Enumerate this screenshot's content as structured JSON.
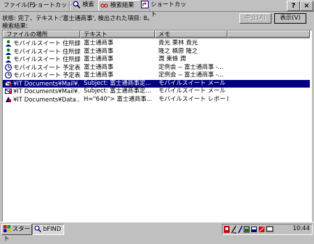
{
  "menubar": {
    "file": "ファイル(F)",
    "shortcut": "ショートカット(S)"
  },
  "tabs": [
    {
      "label": "検索",
      "icon": "magnifier-icon"
    },
    {
      "label": "検索結果",
      "icon": "glasses-icon"
    },
    {
      "label": "ショートカット",
      "icon": "shortcut-icon"
    }
  ],
  "window_buttons": {
    "help": "?",
    "close": "×"
  },
  "status": {
    "text": "状態:  完了、テキスト:'富士通商事',  検出された項目: 8。",
    "results_label": "検索結果:"
  },
  "buttons": {
    "stop": "中止(A)",
    "view": "表示(V)"
  },
  "list": {
    "columns": [
      "ファイルの場所",
      "テキスト",
      "メモ"
    ],
    "rows": [
      {
        "icon": "contact-icon",
        "location": "モバイルスイート 住所録",
        "text": "富士通商事",
        "memo": "貴光 栗林 貴光",
        "selected": false
      },
      {
        "icon": "contact-icon",
        "location": "モバイルスイート 住所録",
        "text": "富士通商事",
        "memo": "隆之 槙原 隆之",
        "selected": false
      },
      {
        "icon": "contact-icon",
        "location": "モバイルスイート 住所録",
        "text": "富士通商事",
        "memo": "潤 東條 潤",
        "selected": false
      },
      {
        "icon": "schedule-icon",
        "location": "モバイルスイート 予定表",
        "text": "富士通商事",
        "memo": "定例会 -- 富士通商事 -...",
        "selected": false
      },
      {
        "icon": "schedule-icon",
        "location": "モバイルスイート 予定表",
        "text": "富士通商事",
        "memo": "定例会 -- 富士通商事 -...",
        "selected": false
      },
      {
        "icon": "mail-icon",
        "location": "¥IT Documents¥Mail¥...",
        "text": "Subject: 富士通商事定...",
        "memo": "モバイルスイート メール",
        "selected": true
      },
      {
        "icon": "mail-icon",
        "location": "¥IT Documents¥Mail¥...",
        "text": "Subject: 富士通商事定...",
        "memo": "モバイルスイート メール",
        "selected": false
      },
      {
        "icon": "report-icon",
        "location": "¥IT Documents¥Data...",
        "text": "H=\"640\"> 富士通商事...",
        "memo": "モバイルスイート レポート",
        "selected": false
      }
    ]
  },
  "taskbar": {
    "start": "スタート",
    "app": "bFIND",
    "clock": "10:44"
  },
  "colors": {
    "selection": "#000080",
    "face": "#c0c0c0",
    "window": "#ffffff"
  }
}
